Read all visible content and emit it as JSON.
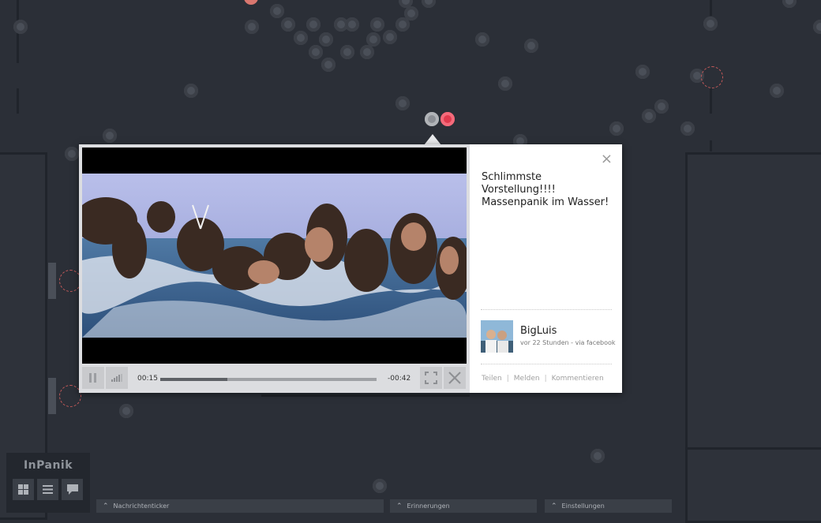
{
  "app": {
    "logo": "InPanik"
  },
  "colors": {
    "accent": "#e13a4e",
    "background": "#2b2f37",
    "panel": "#ffffff"
  },
  "video": {
    "elapsed": "00:15",
    "remaining": "-00:42",
    "progress": 0.31,
    "controls": [
      "pause-icon",
      "volume-icon",
      "fullscreen-icon",
      "close-icon"
    ]
  },
  "post": {
    "text": "Schlimmste Vorstellung!!!! Massenpanik im Wasser!",
    "author": "BigLuis",
    "meta": "vor 22 Stunden - via facebook",
    "actions": {
      "share": "Teilen",
      "report": "Melden",
      "comment": "Kommentieren"
    },
    "close_label": "×"
  },
  "dock": {
    "buttons": [
      "grid-view-icon",
      "list-view-icon",
      "chat-icon"
    ]
  },
  "bottom_tabs": [
    {
      "label": "Nachrichtenticker"
    },
    {
      "label": "Erinnerungen"
    },
    {
      "label": "Einstellungen"
    }
  ]
}
